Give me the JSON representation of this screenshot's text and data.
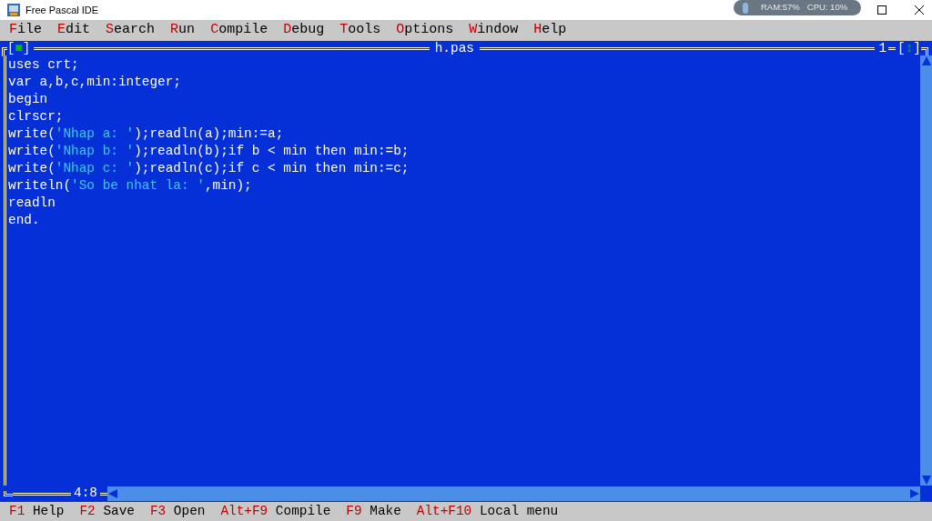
{
  "window": {
    "title": "Free Pascal IDE"
  },
  "system_monitor": {
    "ram": "RAM:57%",
    "cpu": "CPU: 10%"
  },
  "menu": [
    {
      "hotkey": "F",
      "rest": "ile"
    },
    {
      "hotkey": "E",
      "rest": "dit"
    },
    {
      "hotkey": "S",
      "rest": "earch"
    },
    {
      "hotkey": "R",
      "rest": "un"
    },
    {
      "hotkey": "C",
      "rest": "ompile"
    },
    {
      "hotkey": "D",
      "rest": "ebug"
    },
    {
      "hotkey": "T",
      "rest": "ools"
    },
    {
      "hotkey": "O",
      "rest": "ptions"
    },
    {
      "hotkey": "W",
      "rest": "indow"
    },
    {
      "hotkey": "H",
      "rest": "elp"
    }
  ],
  "editor": {
    "close_box": [
      "[",
      "■",
      "]"
    ],
    "zoom_box": [
      "[",
      "↕",
      "]"
    ],
    "title": "h.pas",
    "window_number": "1",
    "cursor_position": "4:8",
    "lines": [
      [
        {
          "kind": "code",
          "text": "uses crt;"
        }
      ],
      [
        {
          "kind": "code",
          "text": "var a,b,c,min:integer;"
        }
      ],
      [
        {
          "kind": "code",
          "text": "begin"
        }
      ],
      [
        {
          "kind": "code",
          "text": "clrscr;"
        }
      ],
      [
        {
          "kind": "code",
          "text": "write("
        },
        {
          "kind": "string",
          "text": "'Nhap a: '"
        },
        {
          "kind": "code",
          "text": ");readln(a);min:=a;"
        }
      ],
      [
        {
          "kind": "code",
          "text": "write("
        },
        {
          "kind": "string",
          "text": "'Nhap b: '"
        },
        {
          "kind": "code",
          "text": ");readln(b);if b < min then min:=b;"
        }
      ],
      [
        {
          "kind": "code",
          "text": "write("
        },
        {
          "kind": "string",
          "text": "'Nhap c: '"
        },
        {
          "kind": "code",
          "text": ");readln(c);if c < min then min:=c;"
        }
      ],
      [
        {
          "kind": "code",
          "text": "writeln("
        },
        {
          "kind": "string",
          "text": "'So be nhat la: '"
        },
        {
          "kind": "code",
          "text": ",min);"
        }
      ],
      [
        {
          "kind": "code",
          "text": "readln"
        }
      ],
      [
        {
          "kind": "code",
          "text": "end."
        }
      ]
    ]
  },
  "status_bar": [
    {
      "key": "F1",
      "label": "Help"
    },
    {
      "key": "F2",
      "label": "Save"
    },
    {
      "key": "F3",
      "label": "Open"
    },
    {
      "key": "Alt+F9",
      "label": "Compile"
    },
    {
      "key": "F9",
      "label": "Make"
    },
    {
      "key": "Alt+F10",
      "label": "Local menu"
    }
  ]
}
